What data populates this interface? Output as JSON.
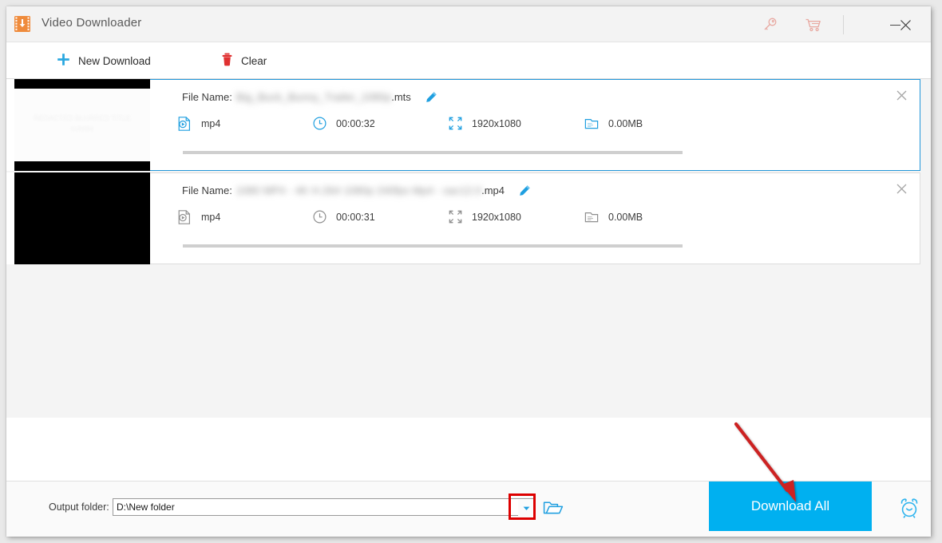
{
  "window": {
    "title": "Video Downloader",
    "app_icon": "film-download-icon",
    "controls": {
      "key_icon": "key-icon",
      "cart_icon": "shopping-cart-icon",
      "minimize": "minimize-icon",
      "close": "close-icon"
    }
  },
  "toolbar": {
    "new_download_label": "New Download",
    "new_download_icon": "plus-icon",
    "clear_label": "Clear",
    "clear_icon": "trash-icon"
  },
  "list": {
    "file_name_label": "File Name:",
    "items": [
      {
        "selected": true,
        "thumbnail": "light-video-thumbnail",
        "thumbnail_blurred_text": "REDACTED BLURRED TITLE\nsubtitle",
        "file_name_redacted": "Big_Buck_Bunny_Trailer_1080p",
        "file_name_ext": ".mts",
        "format": "mp4",
        "duration": "00:00:32",
        "resolution": "1920x1080",
        "size": "0.00MB",
        "progress_percent": 0,
        "edit_icon": "pencil-icon",
        "format_icon": "video-file-icon",
        "duration_icon": "clock-icon",
        "resolution_icon": "resize-frame-icon",
        "size_icon": "document-icon",
        "close_icon": "close-icon"
      },
      {
        "selected": false,
        "thumbnail": "black-video-thumbnail",
        "thumbnail_blurred_text": "",
        "file_name_redacted": "1080 MP4 - 4K H.264 1080p 240fps Mp4 - sac12.0",
        "file_name_ext": ".mp4",
        "format": "mp4",
        "duration": "00:00:31",
        "resolution": "1920x1080",
        "size": "0.00MB",
        "progress_percent": 0,
        "edit_icon": "pencil-icon",
        "format_icon": "video-file-icon",
        "duration_icon": "clock-icon",
        "resolution_icon": "resize-frame-icon",
        "size_icon": "document-icon",
        "close_icon": "close-icon"
      }
    ]
  },
  "bottom": {
    "output_folder_label": "Output folder:",
    "output_folder_value": "D:\\New folder",
    "dropdown_icon": "chevron-down-icon",
    "folder_icon": "open-folder-icon",
    "download_all_label": "Download All",
    "alarm_icon": "alarm-clock-icon"
  },
  "colors": {
    "accent_blue": "#00b0f0",
    "selected_border": "#2196d9",
    "brand_orange": "#ef8b3c",
    "clear_red": "#e03131",
    "annotation_red": "#dd0000"
  },
  "annotations": {
    "arrow_target": "download-all-button",
    "highlight_target": "output-folder-dropdown"
  }
}
